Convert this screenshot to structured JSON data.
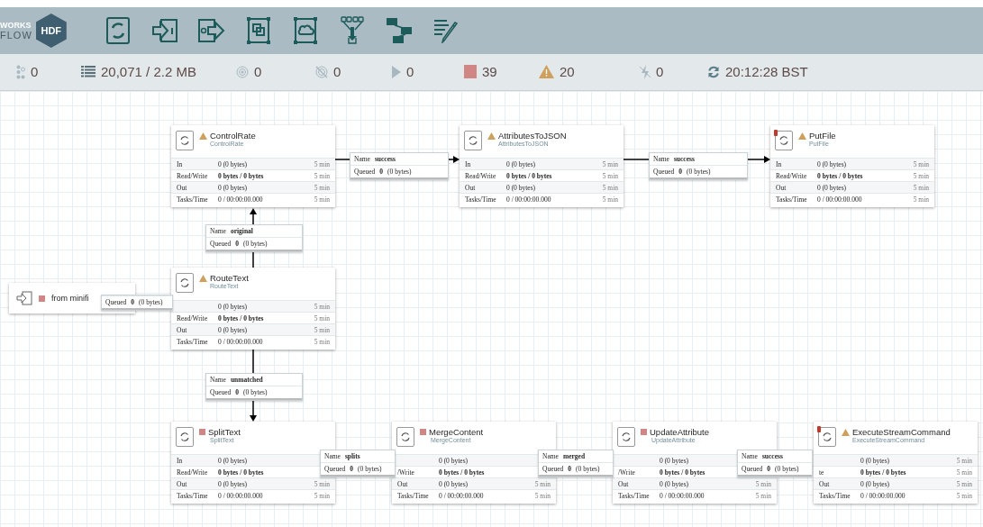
{
  "logo": {
    "brand": "WORKS",
    "product": "FLOW",
    "badge": "HDF"
  },
  "status_bar": [
    {
      "kind": "cluster",
      "text": "0"
    },
    {
      "kind": "queue",
      "text": "20,071 / 2.2 MB"
    },
    {
      "kind": "transmitting",
      "text": "0"
    },
    {
      "kind": "not-transmitting",
      "text": "0"
    },
    {
      "kind": "running",
      "text": "0"
    },
    {
      "kind": "stopped",
      "text": "39"
    },
    {
      "kind": "invalid",
      "text": "20"
    },
    {
      "kind": "disabled",
      "text": "0"
    },
    {
      "kind": "refresh",
      "text": "20:12:28 BST"
    }
  ],
  "processors": [
    {
      "name": "ControlRate",
      "type": "ControlRate",
      "kind": "invalid",
      "alert": false,
      "rows": [
        {
          "label": "In",
          "value": "0 (0 bytes)",
          "time": "5 min"
        },
        {
          "label": "Read/Write",
          "value": "0 bytes / 0 bytes",
          "time": "5 min"
        },
        {
          "label": "Out",
          "value": "0 (0 bytes)",
          "time": "5 min"
        },
        {
          "label": "Tasks/Time",
          "value": "0 / 00:00:00.000",
          "time": "5 min"
        }
      ]
    },
    {
      "name": "AttributesToJSON",
      "type": "AttributesToJSON",
      "kind": "invalid",
      "alert": false,
      "rows": [
        {
          "label": "In",
          "value": "0 (0 bytes)",
          "time": "5 min"
        },
        {
          "label": "Read/Write",
          "value": "0 bytes / 0 bytes",
          "time": "5 min"
        },
        {
          "label": "Out",
          "value": "0 (0 bytes)",
          "time": "5 min"
        },
        {
          "label": "Tasks/Time",
          "value": "0 / 00:00:00.000",
          "time": "5 min"
        }
      ]
    },
    {
      "name": "PutFile",
      "type": "PutFile",
      "kind": "invalid",
      "alert": true,
      "rows": [
        {
          "label": "In",
          "value": "0 (0 bytes)",
          "time": "5 min"
        },
        {
          "label": "Read/Write",
          "value": "0 bytes / 0 bytes",
          "time": "5 min"
        },
        {
          "label": "Out",
          "value": "0 (0 bytes)",
          "time": "5 min"
        },
        {
          "label": "Tasks/Time",
          "value": "0 / 00:00:00.000",
          "time": "5 min"
        }
      ]
    },
    {
      "name": "RouteText",
      "type": "RouteText",
      "kind": "invalid",
      "alert": false,
      "rows": [
        {
          "value": "0 (0 bytes)",
          "time": "5 min"
        },
        {
          "label": "Read/Write",
          "value": "0 bytes / 0 bytes",
          "time": "5 min"
        },
        {
          "label": "Out",
          "value": "0 (0 bytes)",
          "time": "5 min"
        },
        {
          "label": "Tasks/Time",
          "value": "0 / 00:00:00.000",
          "time": "5 min"
        }
      ]
    },
    {
      "name": "SplitText",
      "type": "SplitText",
      "kind": "stopped",
      "alert": false,
      "rows": [
        {
          "label": "In",
          "value": "0 (0 bytes)"
        },
        {
          "label": "Read/Write",
          "value": "0 bytes / 0 bytes"
        },
        {
          "label": "Out",
          "value": "0 (0 bytes)",
          "time": "5 min"
        },
        {
          "label": "Tasks/Time",
          "value": "0 / 00:00:00.000",
          "time": "5 min"
        }
      ]
    },
    {
      "name": "MergeContent",
      "type": "MergeContent",
      "kind": "stopped",
      "alert": false,
      "rows": [
        {
          "value": "0 (0 bytes)"
        },
        {
          "label": "/Write",
          "value": "0 bytes / 0 bytes"
        },
        {
          "label": "Out",
          "value": "0 (0 bytes)",
          "time": "5 min"
        },
        {
          "label": "Tasks/Time",
          "value": "0 / 00:00:00.000",
          "time": "5 min"
        }
      ]
    },
    {
      "name": "UpdateAttribute",
      "type": "UpdateAttribute",
      "kind": "stopped",
      "alert": false,
      "rows": [
        {
          "value": "0 (0 bytes)"
        },
        {
          "label": "/Write",
          "value": "0 bytes / 0 bytes"
        },
        {
          "label": "Out",
          "value": "0 (0 bytes)",
          "time": "5 min"
        },
        {
          "label": "Tasks/Time",
          "value": "0 / 00:00:00.000",
          "time": "5 min"
        }
      ]
    },
    {
      "name": "ExecuteStreamCommand",
      "type": "ExecuteStreamCommand",
      "kind": "invalid",
      "alert": true,
      "rows": [
        {
          "value": "0 (0 bytes)",
          "time": "5 min"
        },
        {
          "label": "te",
          "value": "0 bytes / 0 bytes",
          "time": "5 min"
        },
        {
          "label": "Out",
          "value": "0 (0 bytes)",
          "time": "5 min"
        },
        {
          "label": "Tasks/Time",
          "value": "0 / 00:00:00.000",
          "time": "5 min"
        }
      ]
    }
  ],
  "input_port": {
    "name": "from minifi",
    "kind": "stopped"
  },
  "connections": [
    {
      "name_label": "Name",
      "name": "success",
      "queued_label": "Queued",
      "queued": "0",
      "queued_size": "(0 bytes)"
    },
    {
      "name_label": "Name",
      "name": "success",
      "queued_label": "Queued",
      "queued": "0",
      "queued_size": "(0 bytes)"
    },
    {
      "name_label": "Name",
      "name": "original",
      "queued_label": "Queued",
      "queued": "0",
      "queued_size": "(0 bytes)"
    },
    {
      "queued_label": "Queued",
      "queued": "0",
      "queued_size": "(0 bytes)"
    },
    {
      "name_label": "Name",
      "name": "unmatched",
      "queued_label": "Queued",
      "queued": "0",
      "queued_size": "(0 bytes)"
    },
    {
      "name_label": "Name",
      "name": "splits",
      "queued_label": "Queued",
      "queued": "0",
      "queued_size": "(0 bytes)"
    },
    {
      "name_label": "Name",
      "name": "merged",
      "queued_label": "Queued",
      "queued": "0",
      "queued_size": "(0 bytes)"
    },
    {
      "name_label": "Name",
      "name": "success",
      "queued_label": "Queued",
      "queued": "0",
      "queued_size": "(0 bytes)"
    }
  ]
}
